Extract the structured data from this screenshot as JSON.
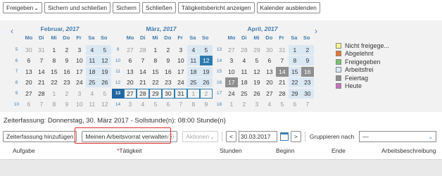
{
  "toolbar": {
    "freigeben": "Freigeben",
    "sichern_schliessen": "Sichern und schließen",
    "sichern": "Sichern",
    "schliessen": "Schließen",
    "bericht": "Tätigkeitsbericht anzeigen",
    "kalender": "Kalender ausblenden"
  },
  "calendar": {
    "daynames": [
      "Mo",
      "Di",
      "Mi",
      "Do",
      "Fr",
      "Sa",
      "So"
    ],
    "months": [
      {
        "name": "Februar,",
        "year": "2017",
        "weeks": [
          {
            "wk": "5",
            "days": [
              {
                "d": "30",
                "o": 1
              },
              {
                "d": "31",
                "o": 1
              },
              {
                "d": "1"
              },
              {
                "d": "2"
              },
              {
                "d": "3"
              },
              {
                "d": "4",
                "we": 1
              },
              {
                "d": "5",
                "we": 1
              }
            ]
          },
          {
            "wk": "6",
            "days": [
              {
                "d": "6"
              },
              {
                "d": "7"
              },
              {
                "d": "8"
              },
              {
                "d": "9"
              },
              {
                "d": "10"
              },
              {
                "d": "11",
                "we": 1
              },
              {
                "d": "12",
                "we": 1
              }
            ]
          },
          {
            "wk": "7",
            "days": [
              {
                "d": "13"
              },
              {
                "d": "14"
              },
              {
                "d": "15"
              },
              {
                "d": "16"
              },
              {
                "d": "17"
              },
              {
                "d": "18",
                "we": 1
              },
              {
                "d": "19",
                "we": 1
              }
            ]
          },
          {
            "wk": "8",
            "days": [
              {
                "d": "20"
              },
              {
                "d": "21"
              },
              {
                "d": "22"
              },
              {
                "d": "23"
              },
              {
                "d": "24"
              },
              {
                "d": "25",
                "we": 1
              },
              {
                "d": "26",
                "we": 1
              }
            ]
          },
          {
            "wk": "9",
            "days": [
              {
                "d": "27"
              },
              {
                "d": "28"
              },
              {
                "d": "1",
                "o": 1
              },
              {
                "d": "2",
                "o": 1
              },
              {
                "d": "3",
                "o": 1
              },
              {
                "d": "4",
                "o": 1
              },
              {
                "d": "5",
                "o": 1
              }
            ]
          },
          {
            "wk": "10",
            "days": [
              {
                "d": "6",
                "o": 1
              },
              {
                "d": "7",
                "o": 1
              },
              {
                "d": "8",
                "o": 1
              },
              {
                "d": "9",
                "o": 1
              },
              {
                "d": "10",
                "o": 1
              },
              {
                "d": "11",
                "o": 1
              },
              {
                "d": "12",
                "o": 1
              }
            ]
          }
        ]
      },
      {
        "name": "März,",
        "year": "2017",
        "weeks": [
          {
            "wk": "9",
            "days": [
              {
                "d": "27",
                "o": 1
              },
              {
                "d": "28",
                "o": 1
              },
              {
                "d": "1"
              },
              {
                "d": "2"
              },
              {
                "d": "3"
              },
              {
                "d": "4",
                "we": 1
              },
              {
                "d": "5",
                "we": 1
              }
            ]
          },
          {
            "wk": "10",
            "days": [
              {
                "d": "6"
              },
              {
                "d": "7"
              },
              {
                "d": "8"
              },
              {
                "d": "9"
              },
              {
                "d": "10"
              },
              {
                "d": "11",
                "we": 1
              },
              {
                "d": "12",
                "sel": 1
              }
            ]
          },
          {
            "wk": "11",
            "days": [
              {
                "d": "13"
              },
              {
                "d": "14"
              },
              {
                "d": "15"
              },
              {
                "d": "16"
              },
              {
                "d": "17"
              },
              {
                "d": "18",
                "we": 1
              },
              {
                "d": "19",
                "we": 1
              }
            ]
          },
          {
            "wk": "12",
            "days": [
              {
                "d": "20"
              },
              {
                "d": "21"
              },
              {
                "d": "22"
              },
              {
                "d": "23"
              },
              {
                "d": "24"
              },
              {
                "d": "25",
                "we": 1
              },
              {
                "d": "26",
                "we": 1
              }
            ]
          },
          {
            "wk": "13",
            "sel": 1,
            "days": [
              {
                "d": "27",
                "today": 1
              },
              {
                "d": "28",
                "today": 1
              },
              {
                "d": "29",
                "today": 1
              },
              {
                "d": "30",
                "today": 1
              },
              {
                "d": "31",
                "today": 1
              },
              {
                "d": "1",
                "o": 1,
                "today": 1
              },
              {
                "d": "2",
                "o": 1,
                "today": 1
              }
            ]
          },
          {
            "wk": "14",
            "days": [
              {
                "d": "3",
                "o": 1
              },
              {
                "d": "4",
                "o": 1
              },
              {
                "d": "5",
                "o": 1
              },
              {
                "d": "6",
                "o": 1
              },
              {
                "d": "7",
                "o": 1
              },
              {
                "d": "8",
                "o": 1
              },
              {
                "d": "9",
                "o": 1
              }
            ]
          }
        ]
      },
      {
        "name": "April,",
        "year": "2017",
        "weeks": [
          {
            "wk": "13",
            "days": [
              {
                "d": "27",
                "o": 1
              },
              {
                "d": "28",
                "o": 1
              },
              {
                "d": "29",
                "o": 1
              },
              {
                "d": "30",
                "o": 1
              },
              {
                "d": "31",
                "o": 1
              },
              {
                "d": "1",
                "we": 1
              },
              {
                "d": "2",
                "we": 1
              }
            ]
          },
          {
            "wk": "14",
            "days": [
              {
                "d": "3"
              },
              {
                "d": "4"
              },
              {
                "d": "5"
              },
              {
                "d": "6"
              },
              {
                "d": "7"
              },
              {
                "d": "8",
                "we": 1
              },
              {
                "d": "9",
                "we": 1
              }
            ]
          },
          {
            "wk": "15",
            "days": [
              {
                "d": "10"
              },
              {
                "d": "11"
              },
              {
                "d": "12"
              },
              {
                "d": "13"
              },
              {
                "d": "14",
                "hol": 1
              },
              {
                "d": "15",
                "we": 1
              },
              {
                "d": "16",
                "hol": 1
              }
            ]
          },
          {
            "wk": "16",
            "days": [
              {
                "d": "17",
                "hol": 1
              },
              {
                "d": "18"
              },
              {
                "d": "19"
              },
              {
                "d": "20"
              },
              {
                "d": "21"
              },
              {
                "d": "22",
                "we": 1
              },
              {
                "d": "23",
                "we": 1
              }
            ]
          },
          {
            "wk": "17",
            "days": [
              {
                "d": "24"
              },
              {
                "d": "25"
              },
              {
                "d": "26"
              },
              {
                "d": "27"
              },
              {
                "d": "28"
              },
              {
                "d": "29",
                "we": 1
              },
              {
                "d": "30",
                "we": 1
              }
            ]
          },
          {
            "wk": "18",
            "days": [
              {
                "d": "1",
                "o": 1
              },
              {
                "d": "2",
                "o": 1
              },
              {
                "d": "3",
                "o": 1
              },
              {
                "d": "4",
                "o": 1
              },
              {
                "d": "5",
                "o": 1
              },
              {
                "d": "6",
                "o": 1
              },
              {
                "d": "7",
                "o": 1
              }
            ]
          }
        ]
      }
    ]
  },
  "legend": [
    {
      "label": "Nicht freigege...",
      "color": "#f7f58e"
    },
    {
      "label": "Abgelehnt",
      "color": "#e8742c"
    },
    {
      "label": "Freigegeben",
      "color": "#7ac36a"
    },
    {
      "label": "Arbeitsfrei",
      "color": "#dae8f4"
    },
    {
      "label": "Feiertag",
      "color": "#8f8f8f"
    },
    {
      "label": "Heute",
      "color": "#c76fc0"
    }
  ],
  "status_line": "Zeiterfassung: Donnerstag, 30. März 2017 - Sollstunde(n): 08:00 Stunde(n)",
  "toolbar2": {
    "add": "Zeiterfassung hinzufügen",
    "worklist": "Meinen Arbeitsvorrat verwalten",
    "actions": "Aktionen",
    "prev": "<",
    "date": "30.03.2017",
    "next": ">",
    "group_label": "Gruppieren nach",
    "group_value": "—"
  },
  "table": {
    "aufgabe": "Aufgabe",
    "required_marker": "*",
    "taetigkeit": "Tätigkeit",
    "stunden": "Stunden",
    "beginn": "Beginn",
    "ende": "Ende",
    "beschreibung": "Arbeitsbeschreibung"
  },
  "colors": {
    "accent": "#427cac",
    "selected": "#2c7cb0",
    "highlight": "#e02a2a"
  }
}
